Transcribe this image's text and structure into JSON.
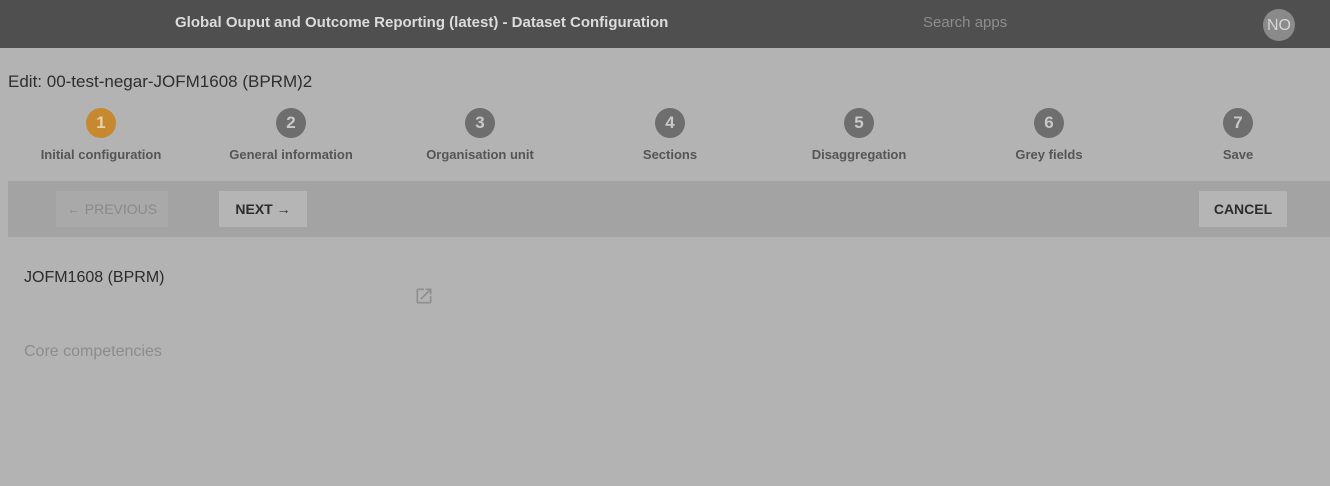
{
  "header": {
    "app_title": "Global Ouput and Outcome Reporting (latest) - Dataset Configuration",
    "search_placeholder": "Search apps",
    "avatar_initials": "NO"
  },
  "page": {
    "heading": "Edit: 00-test-negar-JOFM1608 (BPRM)2"
  },
  "steps": [
    {
      "number": "1",
      "label": "Initial configuration",
      "active": true
    },
    {
      "number": "2",
      "label": "General information",
      "active": false
    },
    {
      "number": "3",
      "label": "Organisation unit",
      "active": false
    },
    {
      "number": "4",
      "label": "Sections",
      "active": false
    },
    {
      "number": "5",
      "label": "Disaggregation",
      "active": false
    },
    {
      "number": "6",
      "label": "Grey fields",
      "active": false
    },
    {
      "number": "7",
      "label": "Save",
      "active": false
    }
  ],
  "toolbar": {
    "previous_label": "← PREVIOUS",
    "next_label": "NEXT →",
    "cancel_label": "CANCEL"
  },
  "form": {
    "selected_value": "JOFM1608 (BPRM)",
    "open_icon": "open-in-new-icon",
    "core_competencies_placeholder": "Core competencies"
  },
  "colors": {
    "header_bg": "#4f4f4f",
    "overlay_bg": "#b3b3b3",
    "active_step": "#c7892e"
  }
}
